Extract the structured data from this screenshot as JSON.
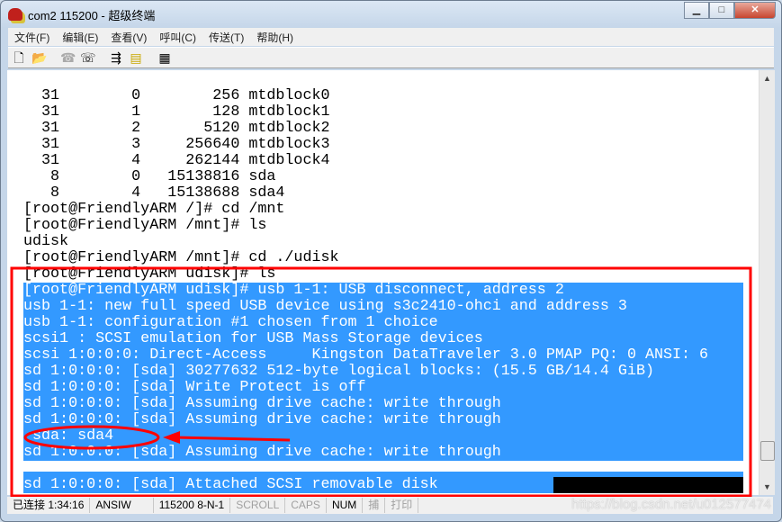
{
  "window": {
    "title": "com2 115200 - 超级终端",
    "buttons": [
      "minimize",
      "maximize",
      "close"
    ]
  },
  "menu": [
    "文件(F)",
    "编辑(E)",
    "查看(V)",
    "呼叫(C)",
    "传送(T)",
    "帮助(H)"
  ],
  "toolbar": [
    "new-icon",
    "open-icon",
    "disconnect-icon",
    "call-icon",
    "send-icon",
    "receive-icon",
    "properties-icon"
  ],
  "terminal": {
    "lines": [
      "  31        0        256 mtdblock0",
      "  31        1        128 mtdblock1",
      "  31        2       5120 mtdblock2",
      "  31        3     256640 mtdblock3",
      "  31        4     262144 mtdblock4",
      "   8        0   15138816 sda",
      "   8        4   15138688 sda4",
      "[root@FriendlyARM /]# cd /mnt",
      "[root@FriendlyARM /mnt]# ls",
      "udisk",
      "[root@FriendlyARM /mnt]# cd ./udisk",
      "[root@FriendlyARM udisk]# ls"
    ],
    "selected_lines": [
      "[root@FriendlyARM udisk]# usb 1-1: USB disconnect, address 2",
      "usb 1-1: new full speed USB device using s3c2410-ohci and address 3",
      "usb 1-1: configuration #1 chosen from 1 choice",
      "scsi1 : SCSI emulation for USB Mass Storage devices",
      "scsi 1:0:0:0: Direct-Access     Kingston DataTraveler 3.0 PMAP PQ: 0 ANSI: 6",
      "sd 1:0:0:0: [sda] 30277632 512-byte logical blocks: (15.5 GB/14.4 GiB)",
      "sd 1:0:0:0: [sda] Write Protect is off",
      "sd 1:0:0:0: [sda] Assuming drive cache: write through",
      "sd 1:0:0:0: [sda] Assuming drive cache: write through",
      " sda: sda4",
      "sd 1:0:0:0: [sda] Assuming drive cache: write through"
    ],
    "last_line": "sd 1:0:0:0: [sda] Attached SCSI removable disk",
    "selection_color": "#3399ff",
    "annotation_color": "#ff0000"
  },
  "status": {
    "connected": "已连接 1:34:16",
    "emulation": "ANSIW",
    "port": "115200 8-N-1",
    "scroll": "SCROLL",
    "caps": "CAPS",
    "num": "NUM",
    "capture": "捕",
    "print": "打印"
  },
  "watermark": "https://blog.csdn.net/u012577474"
}
